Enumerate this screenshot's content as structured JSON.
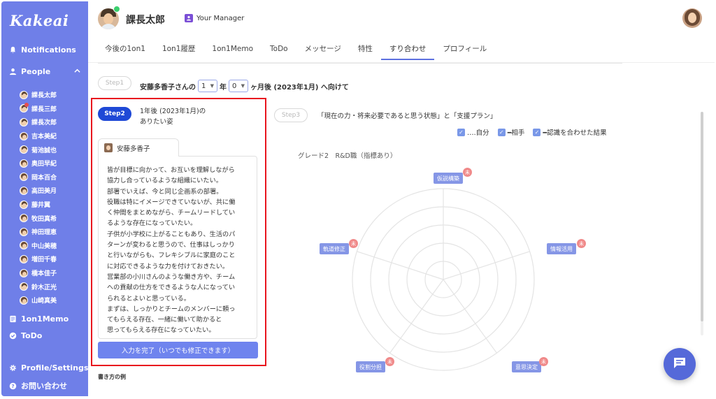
{
  "app": {
    "logo": "Kakeai"
  },
  "sidebar": {
    "notifications": "Notifications",
    "people": "People",
    "people_list": [
      "課長太郎",
      "課長三郎",
      "課長次郎",
      "吉本美紀",
      "菊池誠也",
      "奥田早紀",
      "岡本百合",
      "高田美月",
      "藤井翼",
      "牧田真希",
      "神田理恵",
      "中山美穂",
      "増田千春",
      "橋本佳子",
      "鈴木正光",
      "山崎真美"
    ],
    "memo": "1on1Memo",
    "todo": "ToDo",
    "profile": "Profile/Settings",
    "contact": "お問い合わせ"
  },
  "header": {
    "user_name": "課長太郎",
    "manager_label": "Your Manager",
    "tabs": [
      "今後の1on1",
      "1on1履歴",
      "1on1Memo",
      "ToDo",
      "メッセージ",
      "特性",
      "すり合わせ",
      "プロフィール"
    ],
    "active_tab": "すり合わせ"
  },
  "step1": {
    "label": "Step1",
    "prefix": "安藤多香子さんの",
    "year_value": "1",
    "year_unit": "年",
    "month_value": "0",
    "suffix": "ヶ月後 (2023年1月) へ向けて"
  },
  "step2": {
    "label": "Step2",
    "title_line1": "1年後 (2023年1月)の",
    "title_line2": "ありたい姿",
    "card_author": "安藤多香子",
    "card_lines": [
      "皆が目標に向かって、お互いを理解しながら",
      "協力し合っているような組織にいたい。",
      "部署でいえば、今と同じ企画系の部署。",
      "役職は特にイメージできていないが、共に働",
      "く仲間をまとめながら、チームリードしてい",
      "るような存在になっていたい。",
      "子供が小学校に上がることもあり、生活のパ",
      "ターンが変わると思うので、仕事はしっかり",
      "と行いながらも、フレキシブルに家庭のこと",
      "に対応できるような力を付けておきたい。",
      "営業部の小川さんのような働き方や、チーム",
      "への貢献の仕方をできるような人になってい",
      "られるとよいと思っている。",
      "まずは、しっかりとチームのメンバーに頼っ",
      "てもらえる存在、一緒に働いて助かると",
      "思ってもらえる存在になっていたい。"
    ],
    "complete_button": "入力を完了（いつでも修正できます）",
    "example_link": "書き方の例"
  },
  "step3": {
    "label": "Step3",
    "text": "「現在の力・将来必要であると思う状態」と「支援プラン」",
    "legend": [
      "‥‥自分",
      "━相手",
      "━認識を合わせた結果"
    ],
    "grade": "グレード2　R&D職（指標あり）",
    "axes": [
      "仮説構築",
      "情報活用",
      "意思決定",
      "役割分担",
      "軌道修正"
    ],
    "badge": "未"
  },
  "colors": {
    "sidebar": "#6f7fe8",
    "accent": "#1f49d6",
    "highlight": "#e8141e",
    "button": "#6f84ee"
  }
}
